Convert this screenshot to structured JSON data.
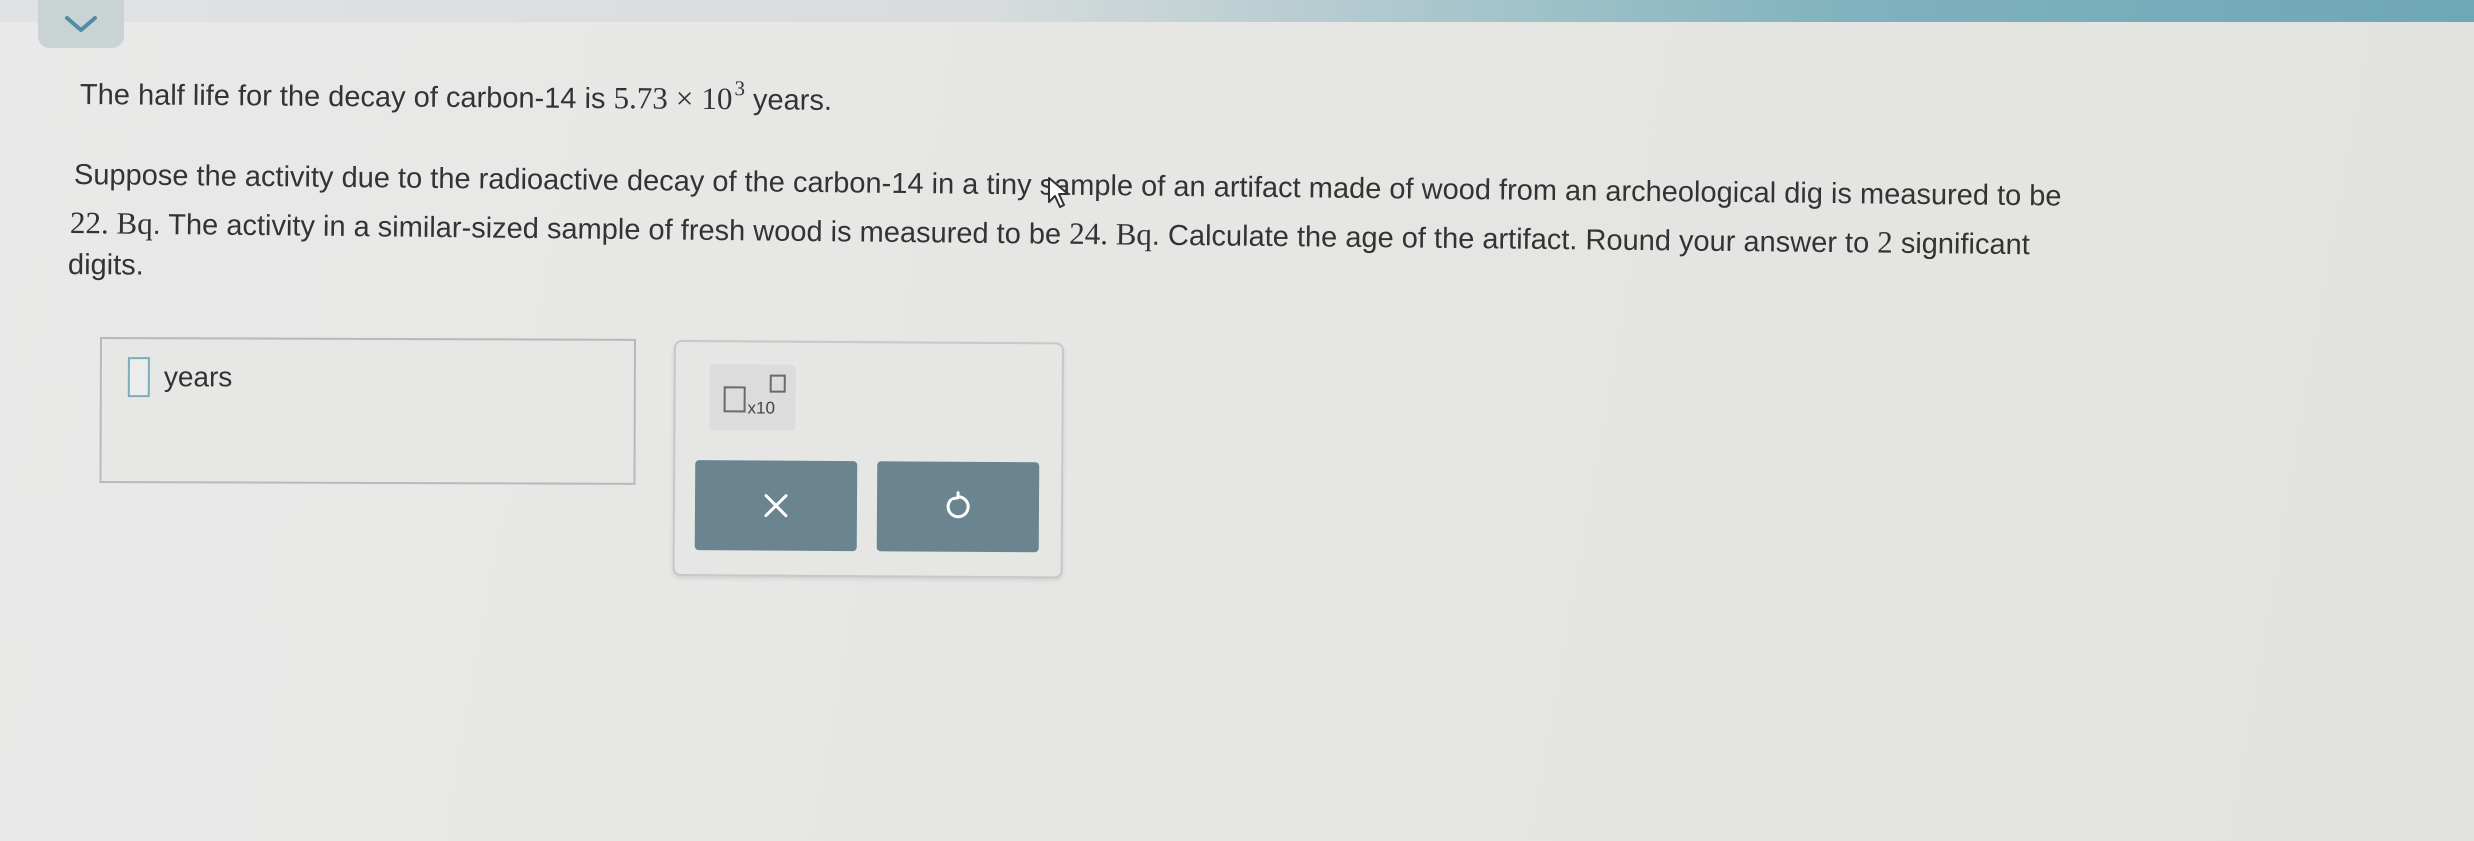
{
  "header": {
    "collapse_icon": "chevron-down-icon"
  },
  "question": {
    "line1_prefix": "The half life for the decay of carbon-14 is",
    "half_life_mantissa": "5.73",
    "times_sign": "×",
    "half_life_base": "10",
    "half_life_exponent": "3",
    "line1_suffix": "years.",
    "p1": "Suppose the activity due to the radioactive decay of the carbon-14 in a tiny sample of an artifact made of wood from an archeological dig is measured to be",
    "p2_value1": "22. Bq",
    "p2_mid": ". The activity in a similar-sized sample of fresh wood is measured to be",
    "p2_value2": "24. Bq",
    "p2_end": ". Calculate the age of the artifact. Round your answer to",
    "sig_figs": "2",
    "p2_tail": "significant",
    "p3": "digits."
  },
  "answer": {
    "value": "",
    "unit": "years"
  },
  "tools": {
    "sci_notation_label": "x10",
    "clear_icon": "x-icon",
    "undo_icon": "undo-icon"
  },
  "colors": {
    "action_button": "#6a8590",
    "input_border": "#7cadbc",
    "top_accent": "#6ea7b6"
  }
}
